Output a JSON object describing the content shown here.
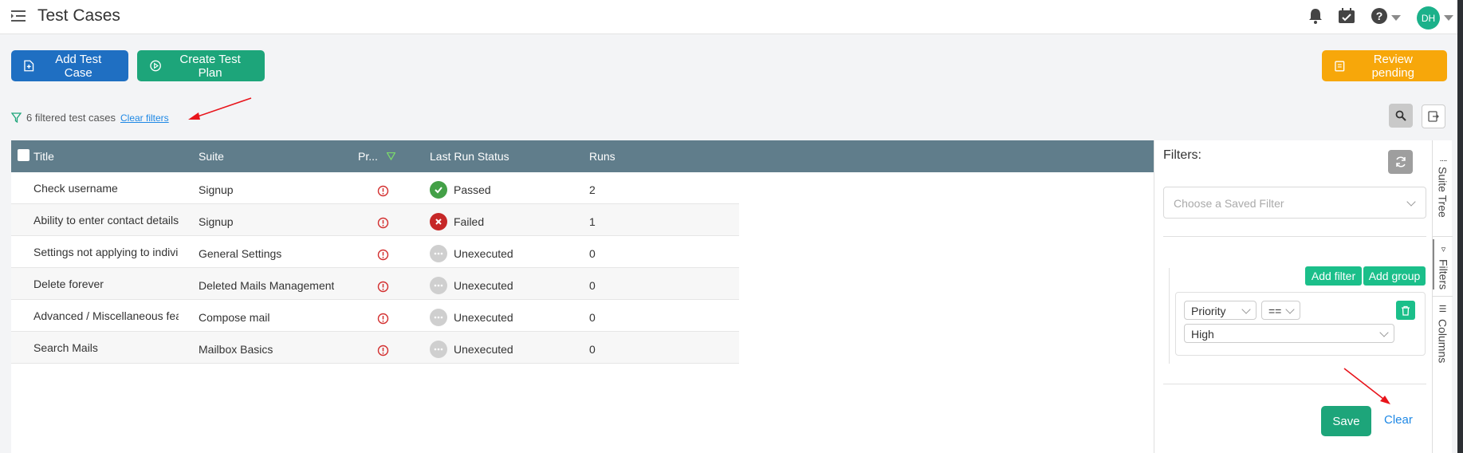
{
  "header": {
    "title": "Test Cases",
    "avatar_initials": "DH",
    "icons": [
      "menu-icon",
      "bell-icon",
      "calendar-check-icon",
      "help-icon",
      "chevron-down-icon"
    ]
  },
  "toolbar": {
    "add_test_case": "Add Test Case",
    "create_test_plan": "Create Test Plan",
    "review_pending": "Review pending"
  },
  "filter_summary": {
    "text": "6 filtered test cases",
    "clear_filters": "Clear filters"
  },
  "table": {
    "columns": [
      "Title",
      "Suite",
      "Pr...",
      "Last Run Status",
      "Runs"
    ],
    "rows": [
      {
        "title": "Check username",
        "suite": "Signup",
        "status": "Passed",
        "runs": "2"
      },
      {
        "title": "Ability to enter contact details",
        "suite": "Signup",
        "status": "Failed",
        "runs": "1"
      },
      {
        "title": "Settings not applying to indivi",
        "suite": "General Settings",
        "status": "Unexecuted",
        "runs": "0"
      },
      {
        "title": "Delete forever",
        "suite": "Deleted Mails Management",
        "status": "Unexecuted",
        "runs": "0"
      },
      {
        "title": "Advanced / Miscellaneous fea",
        "suite": "Compose mail",
        "status": "Unexecuted",
        "runs": "0"
      },
      {
        "title": "Search Mails",
        "suite": "Mailbox Basics",
        "status": "Unexecuted",
        "runs": "0"
      }
    ]
  },
  "filters_panel": {
    "label": "Filters:",
    "saved_filter_placeholder": "Choose a Saved Filter",
    "add_filter": "Add filter",
    "add_group": "Add group",
    "rule": {
      "field": "Priority",
      "operator": "==",
      "value": "High"
    },
    "save": "Save",
    "clear": "Clear"
  },
  "side_tabs": [
    "Suite Tree",
    "Filters",
    "Columns"
  ],
  "colors": {
    "primary_blue": "#1f6fc2",
    "green": "#1da57a",
    "orange": "#f7a70a",
    "table_header": "#607d8b",
    "annotation_red": "#e8141b"
  }
}
